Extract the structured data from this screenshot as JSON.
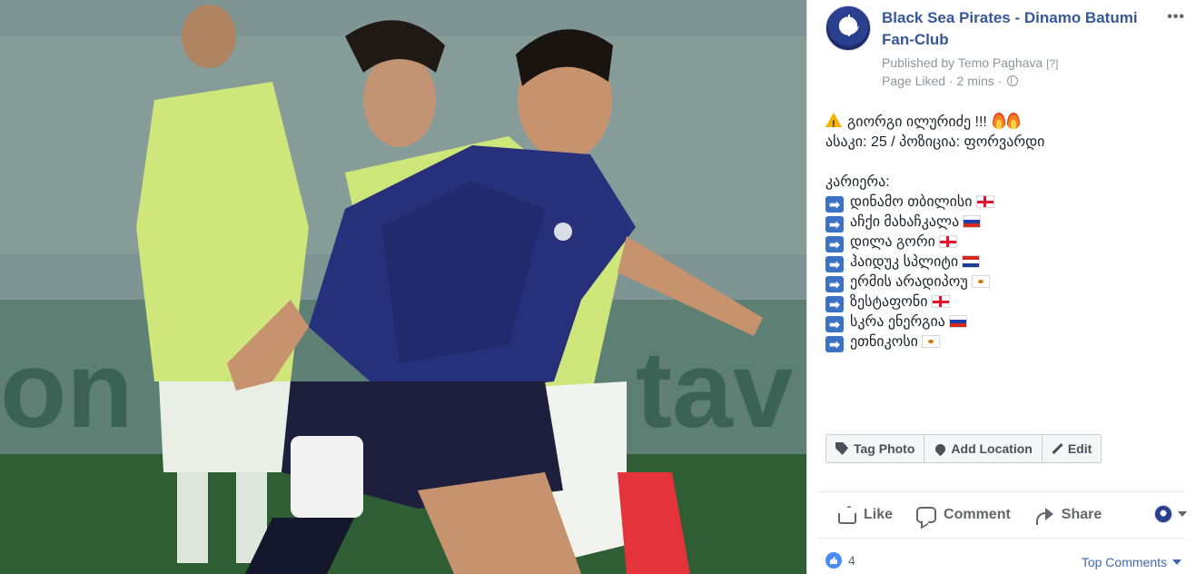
{
  "page": {
    "name": "Black Sea Pirates - Dinamo Batumi Fan-Club",
    "published_by_label": "Published by",
    "publisher": "Temo Paghava",
    "publisher_help": "[?]",
    "status": "Page Liked",
    "separator": " · ",
    "time": "2 mins",
    "menu_icon": "more-dots-icon",
    "privacy_icon": "globe-icon"
  },
  "photo": {
    "description_icon": "football-players-photo",
    "colors": {
      "kit_home": "#1f2a6b",
      "kit_away": "#cfe67a",
      "pitch": "#2f5e35",
      "stand": "#6f8a8a"
    }
  },
  "post": {
    "headline": "გიორგი ილურიძე !!!",
    "headline_icons": [
      "warning-icon",
      "fire-icon",
      "fire-icon"
    ],
    "stats": "ასაკი: 25 / პოზიცია: ფორვარდი",
    "career_title": "კარიერა:",
    "career": [
      {
        "club": "დინამო თბილისი",
        "flag": "georgia"
      },
      {
        "club": "აჩქი მახაჩკალა",
        "flag": "russia"
      },
      {
        "club": "დილა გორი",
        "flag": "georgia"
      },
      {
        "club": "ჰაიდუკ სპლიტი",
        "flag": "croatia"
      },
      {
        "club": "ერმის არადიპოუ",
        "flag": "cyprus"
      },
      {
        "club": "ზესტაფონი",
        "flag": "georgia"
      },
      {
        "club": "სკრა ენერგია",
        "flag": "russia"
      },
      {
        "club": "ეთნიკოსი",
        "flag": "cyprus"
      }
    ],
    "arrow": "➡"
  },
  "photo_actions": {
    "tag_photo": "Tag Photo",
    "add_location": "Add Location",
    "edit": "Edit"
  },
  "actions": {
    "like": "Like",
    "comment": "Comment",
    "share": "Share"
  },
  "reactions": {
    "count": "4",
    "top_comments": "Top Comments"
  },
  "colors": {
    "link": "#365899",
    "meta": "#90949c",
    "action": "#606770",
    "like_blue": "#4a8cf7"
  }
}
